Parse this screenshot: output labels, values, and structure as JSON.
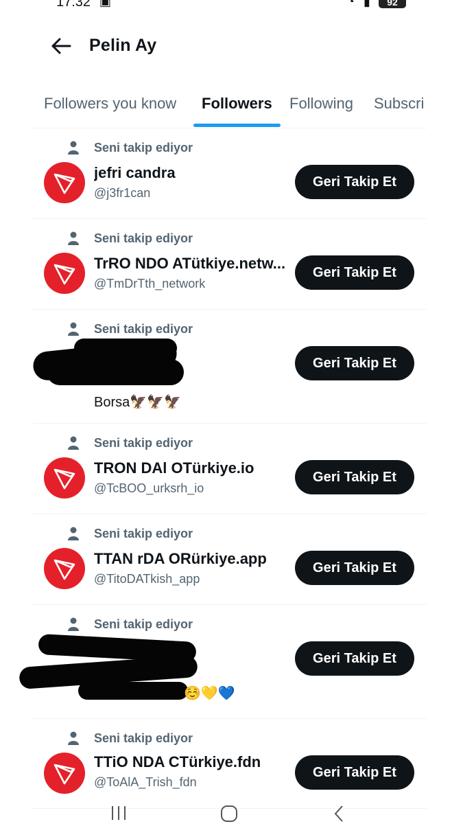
{
  "status_bar": {
    "time": "17:32",
    "battery": "92"
  },
  "header": {
    "title": "Pelin Ay"
  },
  "tabs": [
    {
      "label": "Followers you know",
      "active": false
    },
    {
      "label": "Followers",
      "active": true
    },
    {
      "label": "Following",
      "active": false
    },
    {
      "label": "Subscri",
      "active": false
    }
  ],
  "colors": {
    "accent": "#1d9bf0",
    "button_bg": "#0f1419",
    "avatar_red": "#e4212a",
    "secondary_text": "#536471"
  },
  "followers": [
    {
      "context": "Seni takip ediyor",
      "name": "jefri candra",
      "handle": "@j3fr1can",
      "button": "Geri Takip Et",
      "avatar": "tron-logo"
    },
    {
      "context": "Seni takip ediyor",
      "name": "TrRO NDO ATütkiye.netw...",
      "handle": "@TmDrTth_network",
      "button": "Geri Takip Et",
      "avatar": "tron-logo"
    },
    {
      "context": "Seni takip ediyor",
      "bio": "Borsa🦅🦅🦅",
      "button": "Geri Takip Et",
      "redacted": true
    },
    {
      "context": "Seni takip ediyor",
      "name": "TRON DAl OTürkiye.io",
      "handle": "@TcBOO_urksrh_io",
      "button": "Geri Takip Et",
      "avatar": "tron-logo"
    },
    {
      "context": "Seni takip ediyor",
      "name": "TTAN rDA ORürkiye.app",
      "handle": "@TitoDATkish_app",
      "button": "Geri Takip Et",
      "avatar": "tron-logo"
    },
    {
      "context": "Seni takip ediyor",
      "bio": "☺️💛💙",
      "button": "Geri Takip Et",
      "redacted": true
    },
    {
      "context": "Seni takip ediyor",
      "name": "TTiO NDA CTürkiye.fdn",
      "handle": "@ToAlA_Trish_fdn",
      "button": "Geri Takip Et",
      "avatar": "tron-logo"
    }
  ]
}
